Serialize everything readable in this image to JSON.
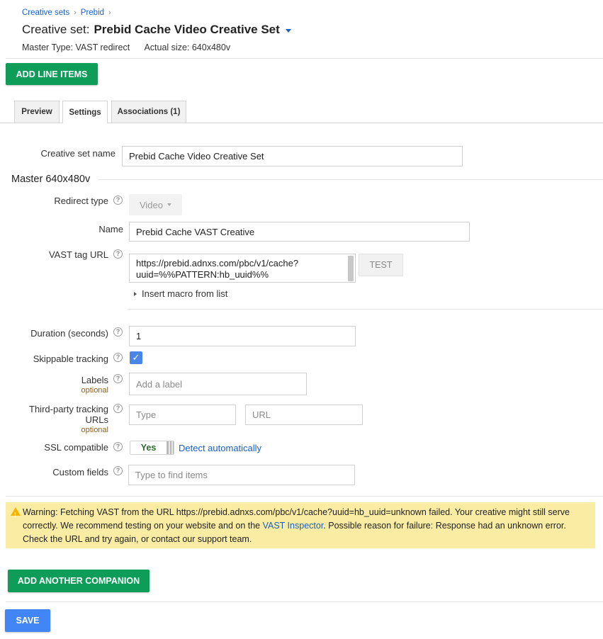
{
  "breadcrumb": {
    "items": [
      "Creative sets",
      "Prebid"
    ],
    "separator": "›"
  },
  "header": {
    "title_prefix": "Creative set:",
    "title_name": "Prebid Cache Video Creative Set",
    "master_type_label": "Master Type:",
    "master_type_value": "VAST redirect",
    "actual_size_label": "Actual size:",
    "actual_size_value": "640x480v"
  },
  "actions": {
    "add_line_items": "ADD LINE ITEMS"
  },
  "tabs": [
    {
      "label": "Preview",
      "active": false
    },
    {
      "label": "Settings",
      "active": true
    },
    {
      "label": "Associations (1)",
      "active": false
    }
  ],
  "form": {
    "creative_set_name": {
      "label": "Creative set name",
      "value": "Prebid Cache Video Creative Set"
    },
    "master_section_title": "Master 640x480v",
    "redirect_type": {
      "label": "Redirect type",
      "value": "Video"
    },
    "name": {
      "label": "Name",
      "value": "Prebid Cache VAST Creative"
    },
    "vast_tag_url": {
      "label": "VAST tag URL",
      "value_line1": "https://prebid.adnxs.com/pbc/v1/cache?",
      "value_line2": "uuid=%%PATTERN:hb_uuid%%",
      "test_button": "TEST",
      "insert_macro": "Insert macro from list"
    },
    "duration": {
      "label": "Duration (seconds)",
      "value": "1"
    },
    "skippable_tracking": {
      "label": "Skippable tracking",
      "checked": true
    },
    "labels": {
      "label": "Labels",
      "optional": "optional",
      "placeholder": "Add a label"
    },
    "third_party": {
      "label_line1": "Third-party tracking",
      "label_line2": "URLs",
      "optional": "optional",
      "type_placeholder": "Type",
      "url_placeholder": "URL"
    },
    "ssl": {
      "label": "SSL compatible",
      "toggle_value": "Yes",
      "detect_link": "Detect automatically"
    },
    "custom_fields": {
      "label": "Custom fields",
      "placeholder": "Type to find items"
    }
  },
  "help_glyph": "?",
  "warning": {
    "icon": "warning-triangle-icon",
    "text_before_link": "Warning: Fetching VAST from the URL https://prebid.adnxs.com/pbc/v1/cache?uuid=hb_uuid=unknown failed. Your creative might still serve correctly. We recommend testing on your website and on the ",
    "link_text": "VAST Inspector",
    "text_after_link": ". Possible reason for failure: Response had an unknown error. Check the URL and try again, or contact our support team."
  },
  "buttons": {
    "add_another_companion": "ADD ANOTHER COMPANION",
    "save": "SAVE"
  },
  "colors": {
    "green_button": "#0d9d58",
    "blue_button": "#4285f4",
    "link": "#1a5fc4",
    "warning_bg": "#fbeca4",
    "optional_text": "#9a5d00"
  }
}
